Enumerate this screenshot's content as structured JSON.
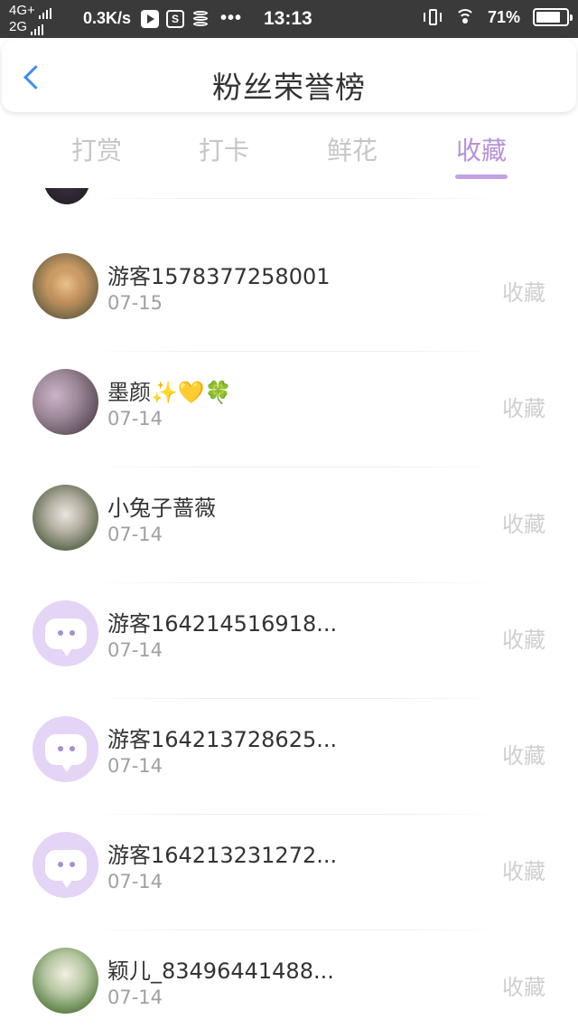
{
  "status_bar": {
    "network_top": "4G+",
    "network_bottom": "2G",
    "speed": "0.3K/s",
    "sim_letter": "S",
    "dots": "•••",
    "time": "13:13",
    "battery_percent": "71%",
    "battery_level": 0.71
  },
  "header": {
    "title": "粉丝荣誉榜",
    "back_icon": "chevron-left-icon"
  },
  "tabs": [
    {
      "label": "打赏",
      "active": false
    },
    {
      "label": "打卡",
      "active": false
    },
    {
      "label": "鲜花",
      "active": false
    },
    {
      "label": "收藏",
      "active": true
    }
  ],
  "colors": {
    "accent": "#b592d8",
    "back_arrow": "#3b8cf0",
    "default_avatar": "#e4d4f6"
  },
  "fans": [
    {
      "name": "游客1578377258001",
      "date": "07-15",
      "action": "收藏",
      "avatar": "photo-dog"
    },
    {
      "name": "墨颜✨💛🍀",
      "date": "07-14",
      "action": "收藏",
      "avatar": "photo-girl"
    },
    {
      "name": "小兔子蔷薇",
      "date": "07-14",
      "action": "收藏",
      "avatar": "photo-anime"
    },
    {
      "name": "游客164214516918...",
      "date": "07-14",
      "action": "收藏",
      "avatar": "default-chat-icon"
    },
    {
      "name": "游客164213728625...",
      "date": "07-14",
      "action": "收藏",
      "avatar": "default-chat-icon"
    },
    {
      "name": "游客164213231272...",
      "date": "07-14",
      "action": "收藏",
      "avatar": "default-chat-icon"
    },
    {
      "name": "颖儿_83496441488...",
      "date": "07-14",
      "action": "收藏",
      "avatar": "photo-child"
    }
  ]
}
